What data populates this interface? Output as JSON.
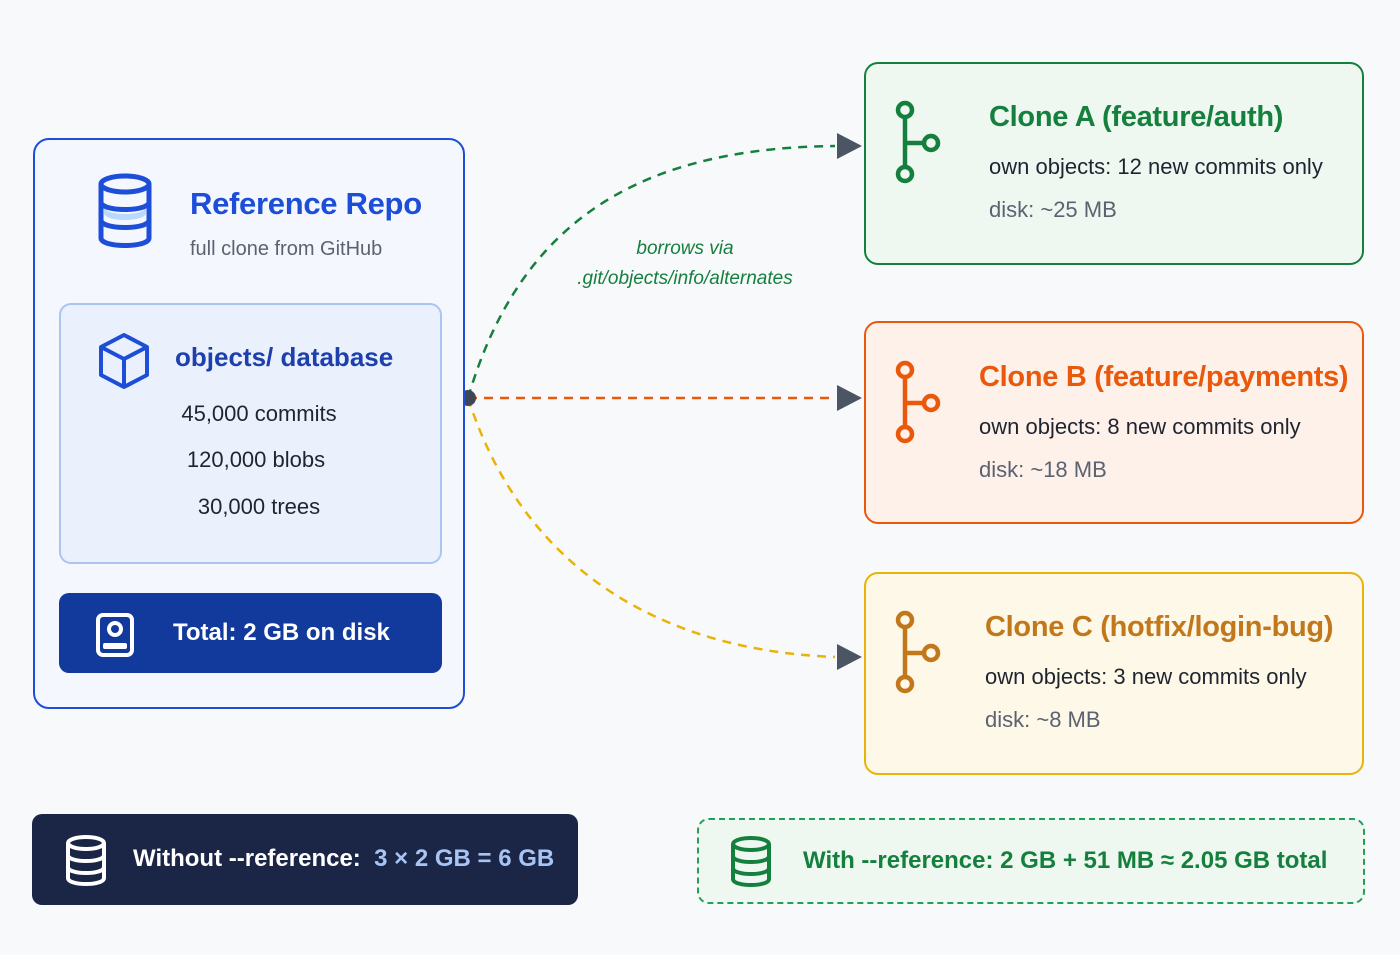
{
  "reference_repo": {
    "title": "Reference Repo",
    "subtitle": "full clone from GitHub",
    "objects": {
      "title": "objects/ database",
      "stats": [
        "45,000 commits",
        "120,000 blobs",
        "30,000 trees"
      ]
    },
    "total": "Total: 2 GB on disk",
    "icons": [
      "database-icon",
      "cube-icon",
      "disk-icon"
    ]
  },
  "link_label": {
    "line1": "borrows via",
    "line2": ".git/objects/info/alternates"
  },
  "clones": [
    {
      "title": "Clone A (feature/auth)",
      "own": "own objects: 12 new commits only",
      "disk": "disk: ~25 MB",
      "color": "#15803d"
    },
    {
      "title": "Clone B (feature/payments)",
      "own": "own objects: 8 new commits only",
      "disk": "disk: ~18 MB",
      "color": "#ea580c"
    },
    {
      "title": "Clone C (hotfix/login-bug)",
      "own": "own objects: 3 new commits only",
      "disk": "disk: ~8 MB",
      "color": "#c2781a"
    }
  ],
  "without": {
    "label": "Without --reference:",
    "value": "3 × 2 GB = 6 GB"
  },
  "with": {
    "text": "With --reference:  2 GB + 51 MB ≈ 2.05 GB total"
  }
}
